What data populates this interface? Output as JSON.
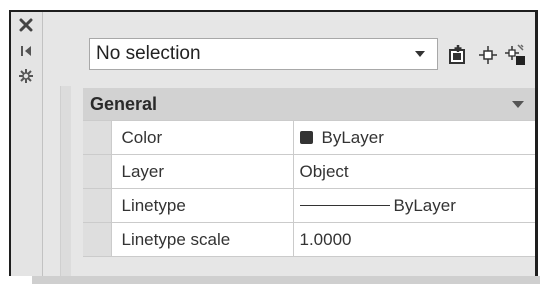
{
  "sidebar": {
    "icons": [
      "close-icon",
      "auto-hide-icon",
      "properties-settings-icon"
    ]
  },
  "toolbar": {
    "selection": "No selection",
    "icons": [
      "toggle-pickadd-icon",
      "select-objects-icon",
      "quick-select-icon"
    ]
  },
  "section": {
    "label": "General"
  },
  "properties": [
    {
      "name": "Color",
      "value": "ByLayer",
      "swatch_color": "#333333"
    },
    {
      "name": "Layer",
      "value": "Object"
    },
    {
      "name": "Linetype",
      "value": "ByLayer"
    },
    {
      "name": "Linetype scale",
      "value": "1.0000"
    }
  ],
  "colors": {
    "palette_bg": "#e6e6e6",
    "header_bg": "#d2d2d2",
    "table_bg": "#ffffff"
  }
}
